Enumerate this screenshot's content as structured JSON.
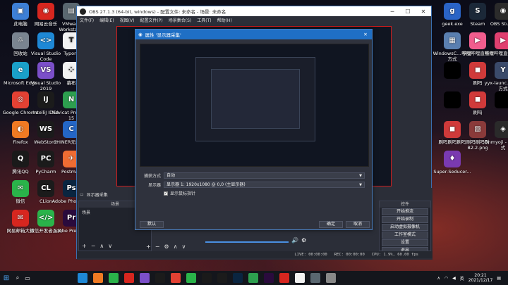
{
  "desktop_left": [
    {
      "label": "此电脑",
      "icon": "computer-icon",
      "color": "#3d7fd6",
      "glyph": "▣"
    },
    {
      "label": "网易云音乐",
      "icon": "netease-music-icon",
      "color": "#d7261f",
      "glyph": "◉"
    },
    {
      "label": "VMware Workstat...",
      "icon": "vmware-icon",
      "color": "#5a6770",
      "glyph": "▤"
    },
    {
      "label": "回收站",
      "icon": "recycle-bin-icon",
      "color": "#7a8490",
      "glyph": "♲"
    },
    {
      "label": "Visual Studio Code",
      "icon": "vscode-icon",
      "color": "#1e88d6",
      "glyph": "<>"
    },
    {
      "label": "Typora",
      "icon": "typora-icon",
      "color": "#f2f2f2",
      "glyph": "T"
    },
    {
      "label": "Microsoft Edge",
      "icon": "edge-icon",
      "color": "#1aa0c8",
      "glyph": "e"
    },
    {
      "label": "Visual Studio 2019",
      "icon": "visual-studio-icon",
      "color": "#7b4fc9",
      "glyph": "VS"
    },
    {
      "label": "幕布",
      "icon": "mubu-icon",
      "color": "#f2f2f2",
      "glyph": "⁘"
    },
    {
      "label": "Google Chrome",
      "icon": "chrome-icon",
      "color": "#e34133",
      "glyph": "◎"
    },
    {
      "label": "IntelliJ IDEA",
      "icon": "intellij-icon",
      "color": "#1b1b1b",
      "glyph": "IJ"
    },
    {
      "label": "Navicat Premium 15",
      "icon": "navicat-icon",
      "color": "#2d9f4f",
      "glyph": "N"
    },
    {
      "label": "Firefox",
      "icon": "firefox-icon",
      "color": "#f07a23",
      "glyph": "◐"
    },
    {
      "label": "WebStorm",
      "icon": "webstorm-icon",
      "color": "#1b1b1b",
      "glyph": "WS"
    },
    {
      "label": "CHINER元数建模",
      "icon": "chiner-icon",
      "color": "#2466c6",
      "glyph": "C"
    },
    {
      "label": "腾讯QQ",
      "icon": "qq-icon",
      "color": "#1a1a1a",
      "glyph": "Q"
    },
    {
      "label": "PyCharm",
      "icon": "pycharm-icon",
      "color": "#1b1b1b",
      "glyph": "PC"
    },
    {
      "label": "Postman",
      "icon": "postman-icon",
      "color": "#ef6c33",
      "glyph": "✈"
    },
    {
      "label": "微信",
      "icon": "wechat-icon",
      "color": "#2ab34a",
      "glyph": "✉"
    },
    {
      "label": "CLion",
      "icon": "clion-icon",
      "color": "#1b1b1b",
      "glyph": "CL"
    },
    {
      "label": "Adobe Photosh...",
      "icon": "photoshop-icon",
      "color": "#0a2540",
      "glyph": "Ps"
    },
    {
      "label": "网易邮箱大师",
      "icon": "netease-mail-icon",
      "color": "#d7261f",
      "glyph": "✉"
    },
    {
      "label": "微信开发者工具",
      "icon": "wechat-devtools-icon",
      "color": "#2ab34a",
      "glyph": "</>"
    },
    {
      "label": "Adobe Premie...",
      "icon": "premiere-icon",
      "color": "#2a0b3d",
      "glyph": "Pr"
    }
  ],
  "desktop_right": [
    {
      "label": "geek.exe",
      "icon": "geek-icon",
      "color": "#2a64c6",
      "glyph": "g"
    },
    {
      "label": "Steam",
      "icon": "steam-icon",
      "color": "#1b2838",
      "glyph": "S"
    },
    {
      "label": "OBS Studio",
      "icon": "obs-icon",
      "color": "#2b2b2b",
      "glyph": "◉"
    },
    {
      "label": "WindowsC... 快捷方式",
      "icon": "windows-shortcut-icon",
      "color": "#5a7fb0",
      "glyph": "▦"
    },
    {
      "label": "哔哩哔哩直播姬",
      "icon": "bilibili-live-icon",
      "color": "#f25d8e",
      "glyph": "▶"
    },
    {
      "label": "哔哩哔哩直播工具",
      "icon": "bilibili-tool-icon",
      "color": "#e04070",
      "glyph": "▶"
    },
    {
      "label": "",
      "icon": "app-blank-icon",
      "color": "#000000",
      "glyph": ""
    },
    {
      "label": "刷吗",
      "icon": "shuama-icon",
      "color": "#d03a3a",
      "glyph": "◼"
    },
    {
      "label": "yyx-launc... 快捷方式",
      "icon": "yyx-launcher-icon",
      "color": "#3a4a6a",
      "glyph": "Y"
    },
    {
      "label": "",
      "icon": "app-blank-icon",
      "color": "#000000",
      "glyph": ""
    },
    {
      "label": "刷吗",
      "icon": "shuama-icon",
      "color": "#d03a3a",
      "glyph": "◼"
    },
    {
      "label": "",
      "icon": "app-blank-icon",
      "color": "#000000",
      "glyph": ""
    },
    {
      "label": "刷吗刷吗刷吗",
      "icon": "shuama-icon",
      "color": "#d03a3a",
      "glyph": "◼"
    },
    {
      "label": "刷吗刷吗刷 B2.2.png",
      "icon": "image-file-icon",
      "color": "#8a3a3a",
      "glyph": "▧"
    },
    {
      "label": "Onmyoji - 快捷方式",
      "icon": "onmyoji-icon",
      "color": "#2a2a2a",
      "glyph": "◈"
    },
    {
      "label": "Super-Seducer...",
      "icon": "super-seducer-icon",
      "color": "#7a3ab0",
      "glyph": "♦"
    }
  ],
  "obs": {
    "title": "OBS 27.1.3 (64-bit, windows) - 配置文件: 未命名 - 场景: 未命名",
    "menu": [
      "文件(F)",
      "编辑(E)",
      "视图(V)",
      "配置文件(P)",
      "场景集合(S)",
      "工具(T)",
      "帮助(H)"
    ],
    "source_bar_label": "显示器采集",
    "scenes_header": "场景",
    "scenes_item": "场景",
    "controls_header": "控件",
    "controls": [
      "开始推流",
      "开始录制",
      "启动虚拟摄像机",
      "工作室模式",
      "设置",
      "退出"
    ],
    "status": {
      "live": "LIVE: 00:00:00",
      "rec": "REC: 00:00:00",
      "cpu": "CPU: 1.9%, 60.00 fps"
    }
  },
  "dialog": {
    "title": "属性 '显示器采集'",
    "capture_method_label": "捕获方式",
    "capture_method_value": "自动",
    "display_label": "显示器",
    "display_value": "显示器 1: 1920x1080 @ 0,0 (主显示器)",
    "cursor_label": "显示鼠标指针",
    "default_button": "默认",
    "ok_button": "确定",
    "cancel_button": "取消"
  },
  "taskbar": {
    "time": "20:21",
    "date": "2021/12/17",
    "ime": "英"
  }
}
